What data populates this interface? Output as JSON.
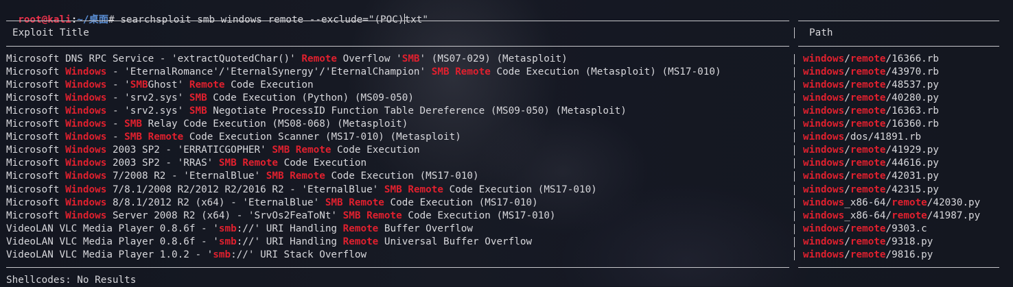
{
  "prompt": {
    "user": "root@kali",
    "sep": ":",
    "path": "~/桌面",
    "symbol": "#",
    "command_before_cursor": "searchsploit smb windows remote --exclude=\"(POC)",
    "command_after_cursor": "txt\""
  },
  "header": {
    "title_label": "Exploit Title",
    "path_label": "Path"
  },
  "rows": [
    {
      "title": [
        [
          "Microsoft DNS RPC Service - 'extractQuotedChar()' ",
          0
        ],
        [
          "Remote",
          1
        ],
        [
          " Overflow '",
          0
        ],
        [
          "SMB",
          1
        ],
        [
          "' (MS07-029) (Metasploit)",
          0
        ]
      ],
      "path": [
        [
          "windows",
          1
        ],
        [
          "/",
          0
        ],
        [
          "remote",
          1
        ],
        [
          "/16366.rb",
          0
        ]
      ]
    },
    {
      "title": [
        [
          "Microsoft ",
          0
        ],
        [
          "Windows",
          1
        ],
        [
          " - 'EternalRomance'/'EternalSynergy'/'EternalChampion' ",
          0
        ],
        [
          "SMB",
          1
        ],
        [
          " ",
          0
        ],
        [
          "Remote",
          1
        ],
        [
          " Code Execution (Metasploit) (MS17-010)",
          0
        ]
      ],
      "path": [
        [
          "windows",
          1
        ],
        [
          "/",
          0
        ],
        [
          "remote",
          1
        ],
        [
          "/43970.rb",
          0
        ]
      ]
    },
    {
      "title": [
        [
          "Microsoft ",
          0
        ],
        [
          "Windows",
          1
        ],
        [
          " - '",
          0
        ],
        [
          "SMB",
          1
        ],
        [
          "Ghost' ",
          0
        ],
        [
          "Remote",
          1
        ],
        [
          " Code Execution",
          0
        ]
      ],
      "path": [
        [
          "windows",
          1
        ],
        [
          "/",
          0
        ],
        [
          "remote",
          1
        ],
        [
          "/48537.py",
          0
        ]
      ]
    },
    {
      "title": [
        [
          "Microsoft ",
          0
        ],
        [
          "Windows",
          1
        ],
        [
          " - 'srv2.sys' ",
          0
        ],
        [
          "SMB",
          1
        ],
        [
          " Code Execution (Python) (MS09-050)",
          0
        ]
      ],
      "path": [
        [
          "windows",
          1
        ],
        [
          "/",
          0
        ],
        [
          "remote",
          1
        ],
        [
          "/40280.py",
          0
        ]
      ]
    },
    {
      "title": [
        [
          "Microsoft ",
          0
        ],
        [
          "Windows",
          1
        ],
        [
          " - 'srv2.sys' ",
          0
        ],
        [
          "SMB",
          1
        ],
        [
          " Negotiate ProcessID Function Table Dereference (MS09-050) (Metasploit)",
          0
        ]
      ],
      "path": [
        [
          "windows",
          1
        ],
        [
          "/",
          0
        ],
        [
          "remote",
          1
        ],
        [
          "/16363.rb",
          0
        ]
      ]
    },
    {
      "title": [
        [
          "Microsoft ",
          0
        ],
        [
          "Windows",
          1
        ],
        [
          " - ",
          0
        ],
        [
          "SMB",
          1
        ],
        [
          " Relay Code Execution (MS08-068) (Metasploit)",
          0
        ]
      ],
      "path": [
        [
          "windows",
          1
        ],
        [
          "/",
          0
        ],
        [
          "remote",
          1
        ],
        [
          "/16360.rb",
          0
        ]
      ]
    },
    {
      "title": [
        [
          "Microsoft ",
          0
        ],
        [
          "Windows",
          1
        ],
        [
          " - ",
          0
        ],
        [
          "SMB",
          1
        ],
        [
          " ",
          0
        ],
        [
          "Remote",
          1
        ],
        [
          " Code Execution Scanner (MS17-010) (Metasploit)",
          0
        ]
      ],
      "path": [
        [
          "windows",
          1
        ],
        [
          "/dos/41891.rb",
          0
        ]
      ]
    },
    {
      "title": [
        [
          "Microsoft ",
          0
        ],
        [
          "Windows",
          1
        ],
        [
          " 2003 SP2 - 'ERRATICGOPHER' ",
          0
        ],
        [
          "SMB",
          1
        ],
        [
          " ",
          0
        ],
        [
          "Remote",
          1
        ],
        [
          " Code Execution",
          0
        ]
      ],
      "path": [
        [
          "windows",
          1
        ],
        [
          "/",
          0
        ],
        [
          "remote",
          1
        ],
        [
          "/41929.py",
          0
        ]
      ]
    },
    {
      "title": [
        [
          "Microsoft ",
          0
        ],
        [
          "Windows",
          1
        ],
        [
          " 2003 SP2 - 'RRAS' ",
          0
        ],
        [
          "SMB",
          1
        ],
        [
          " ",
          0
        ],
        [
          "Remote",
          1
        ],
        [
          " Code Execution",
          0
        ]
      ],
      "path": [
        [
          "windows",
          1
        ],
        [
          "/",
          0
        ],
        [
          "remote",
          1
        ],
        [
          "/44616.py",
          0
        ]
      ]
    },
    {
      "title": [
        [
          "Microsoft ",
          0
        ],
        [
          "Windows",
          1
        ],
        [
          " 7/2008 R2 - 'EternalBlue' ",
          0
        ],
        [
          "SMB",
          1
        ],
        [
          " ",
          0
        ],
        [
          "Remote",
          1
        ],
        [
          " Code Execution (MS17-010)",
          0
        ]
      ],
      "path": [
        [
          "windows",
          1
        ],
        [
          "/",
          0
        ],
        [
          "remote",
          1
        ],
        [
          "/42031.py",
          0
        ]
      ]
    },
    {
      "title": [
        [
          "Microsoft ",
          0
        ],
        [
          "Windows",
          1
        ],
        [
          " 7/8.1/2008 R2/2012 R2/2016 R2 - 'EternalBlue' ",
          0
        ],
        [
          "SMB",
          1
        ],
        [
          " ",
          0
        ],
        [
          "Remote",
          1
        ],
        [
          " Code Execution (MS17-010)",
          0
        ]
      ],
      "path": [
        [
          "windows",
          1
        ],
        [
          "/",
          0
        ],
        [
          "remote",
          1
        ],
        [
          "/42315.py",
          0
        ]
      ]
    },
    {
      "title": [
        [
          "Microsoft ",
          0
        ],
        [
          "Windows",
          1
        ],
        [
          " 8/8.1/2012 R2 (x64) - 'EternalBlue' ",
          0
        ],
        [
          "SMB",
          1
        ],
        [
          " ",
          0
        ],
        [
          "Remote",
          1
        ],
        [
          " Code Execution (MS17-010)",
          0
        ]
      ],
      "path": [
        [
          "windows",
          1
        ],
        [
          "_x86-64/",
          0
        ],
        [
          "remote",
          1
        ],
        [
          "/42030.py",
          0
        ]
      ]
    },
    {
      "title": [
        [
          "Microsoft ",
          0
        ],
        [
          "Windows",
          1
        ],
        [
          " Server 2008 R2 (x64) - 'SrvOs2FeaToNt' ",
          0
        ],
        [
          "SMB",
          1
        ],
        [
          " ",
          0
        ],
        [
          "Remote",
          1
        ],
        [
          " Code Execution (MS17-010)",
          0
        ]
      ],
      "path": [
        [
          "windows",
          1
        ],
        [
          "_x86-64/",
          0
        ],
        [
          "remote",
          1
        ],
        [
          "/41987.py",
          0
        ]
      ]
    },
    {
      "title": [
        [
          "VideoLAN VLC Media Player 0.8.6f - '",
          0
        ],
        [
          "smb",
          1
        ],
        [
          "://' URI Handling ",
          0
        ],
        [
          "Remote",
          1
        ],
        [
          " Buffer Overflow",
          0
        ]
      ],
      "path": [
        [
          "windows",
          1
        ],
        [
          "/",
          0
        ],
        [
          "remote",
          1
        ],
        [
          "/9303.c",
          0
        ]
      ]
    },
    {
      "title": [
        [
          "VideoLAN VLC Media Player 0.8.6f - '",
          0
        ],
        [
          "smb",
          1
        ],
        [
          "://' URI Handling ",
          0
        ],
        [
          "Remote",
          1
        ],
        [
          " Universal Buffer Overflow",
          0
        ]
      ],
      "path": [
        [
          "windows",
          1
        ],
        [
          "/",
          0
        ],
        [
          "remote",
          1
        ],
        [
          "/9318.py",
          0
        ]
      ]
    },
    {
      "title": [
        [
          "VideoLAN VLC Media Player 1.0.2 - '",
          0
        ],
        [
          "smb",
          1
        ],
        [
          "://' URI Stack Overflow",
          0
        ]
      ],
      "path": [
        [
          "windows",
          1
        ],
        [
          "/",
          0
        ],
        [
          "remote",
          1
        ],
        [
          "/9816.py",
          0
        ]
      ]
    }
  ],
  "footer": {
    "shellcodes": "Shellcodes: No Results"
  },
  "colors": {
    "highlight": "#e0202e",
    "prompt_user": "#e8324b",
    "prompt_path": "#5b8fd6",
    "text": "#d8d8dc",
    "background": "#141721"
  }
}
